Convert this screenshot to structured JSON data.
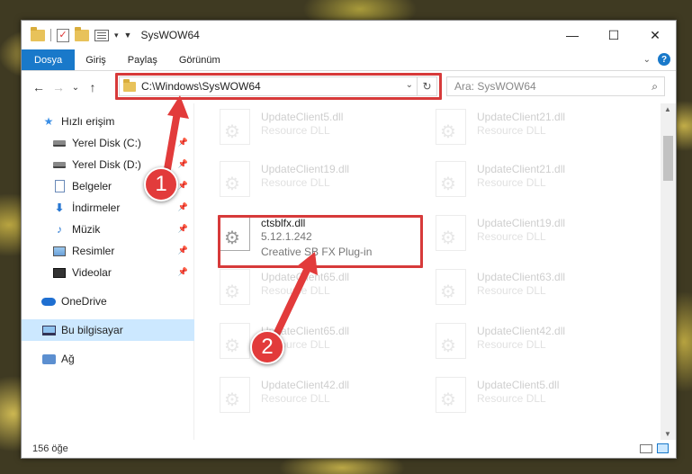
{
  "window": {
    "title": "SysWOW64",
    "controls": {
      "minimize": "—",
      "maximize": "☐",
      "close": "✕"
    }
  },
  "ribbon": {
    "tabs": [
      "Dosya",
      "Giriş",
      "Paylaş",
      "Görünüm"
    ],
    "help": "?"
  },
  "nav": {
    "back": "←",
    "forward": "→",
    "recent": "⌄",
    "up": "↑",
    "address": "C:\\Windows\\SysWOW64",
    "refresh": "↻",
    "search_placeholder": "Ara: SysWOW64",
    "search_icon": "⌕"
  },
  "sidebar": {
    "items": [
      {
        "label": "Hızlı erişim",
        "icon": "star-icon",
        "indent": 0,
        "pinned": false
      },
      {
        "label": "Yerel Disk (C:)",
        "icon": "drive-icon",
        "indent": 1,
        "pinned": true
      },
      {
        "label": "Yerel Disk (D:)",
        "icon": "drive-icon",
        "indent": 1,
        "pinned": true
      },
      {
        "label": "Belgeler",
        "icon": "document-icon",
        "indent": 1,
        "pinned": true
      },
      {
        "label": "İndirmeler",
        "icon": "download-icon",
        "indent": 1,
        "pinned": true
      },
      {
        "label": "Müzik",
        "icon": "music-icon",
        "indent": 1,
        "pinned": true
      },
      {
        "label": "Resimler",
        "icon": "image-icon",
        "indent": 1,
        "pinned": true
      },
      {
        "label": "Videolar",
        "icon": "video-icon",
        "indent": 1,
        "pinned": true
      },
      {
        "label": "OneDrive",
        "icon": "cloud-icon",
        "indent": 0,
        "pinned": false
      },
      {
        "label": "Bu bilgisayar",
        "icon": "computer-icon",
        "indent": 0,
        "pinned": false,
        "selected": true
      },
      {
        "label": "Ağ",
        "icon": "network-icon",
        "indent": 0,
        "pinned": false
      }
    ]
  },
  "files": [
    {
      "name": "UpdateClient5.dll",
      "meta": "Resource DLL",
      "faded": true
    },
    {
      "name": "UpdateClient21.dll",
      "meta": "Resource DLL",
      "faded": true
    },
    {
      "name": "UpdateClient19.dll",
      "meta": "Resource DLL",
      "faded": true
    },
    {
      "name": "UpdateClient21.dll",
      "meta": "Resource DLL",
      "faded": true
    },
    {
      "name": "ctsblfx.dll",
      "version": "5.12.1.242",
      "meta": "Creative SB FX Plug-in",
      "faded": false
    },
    {
      "name": "UpdateClient19.dll",
      "meta": "Resource DLL",
      "faded": true
    },
    {
      "name": "UpdateClient65.dll",
      "meta": "Resource DLL",
      "faded": true
    },
    {
      "name": "UpdateClient63.dll",
      "meta": "Resource DLL",
      "faded": true
    },
    {
      "name": "UpdateClient65.dll",
      "meta": "Resource DLL",
      "faded": true
    },
    {
      "name": "UpdateClient42.dll",
      "meta": "Resource DLL",
      "faded": true
    },
    {
      "name": "UpdateClient42.dll",
      "meta": "Resource DLL",
      "faded": true
    },
    {
      "name": "UpdateClient5.dll",
      "meta": "Resource DLL",
      "faded": true
    }
  ],
  "status": {
    "count": "156 öğe"
  },
  "annotations": [
    {
      "label": "1",
      "color": "#e23b3b"
    },
    {
      "label": "2",
      "color": "#e23b3b"
    }
  ],
  "colors": {
    "accent": "#1979ca",
    "highlight": "#d73a3a",
    "selection": "#cce8ff"
  }
}
